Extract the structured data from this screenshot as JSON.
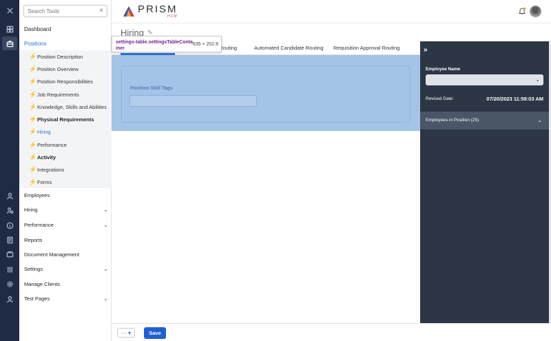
{
  "rail": {
    "close_icon": "close-icon",
    "items_top": [
      "dashboard-icon",
      "briefcase-icon"
    ],
    "items_bottom": [
      "user-icon",
      "users-icon",
      "info-icon",
      "report-icon",
      "document-icon",
      "sliders-icon",
      "gear-icon",
      "person-icon"
    ]
  },
  "sidebar": {
    "search_placeholder": "Search Tools",
    "clear": "×",
    "dashboard": "Dashboard",
    "positions": "Positions",
    "position_items": [
      "Position Description",
      "Position Overview",
      "Position Responsibilities",
      "Job Requirements",
      "Knowledge, Skills and Abilities",
      "Physical Requirements",
      "Hiring",
      "Performance",
      "Activity",
      "Integrations",
      "Forms"
    ],
    "bottom_items": [
      "Employees",
      "Hiring",
      "Performance",
      "Reports",
      "Document Management",
      "Settings",
      "Manage Clients",
      "Test Pages"
    ],
    "chevron": "⌄",
    "bolt": "⚡"
  },
  "header": {
    "logo_word": "PRISM",
    "logo_sub": "HCM"
  },
  "main": {
    "title": "Hiring",
    "edit_glyph": "✎",
    "tabs": [
      "n Routing",
      "Automated Candidate Routing",
      "Requisition Approval Routing"
    ],
    "skill_tags_label": "Position Skill Tags"
  },
  "tooltip": {
    "name": "settings-table.settingsTableContainer",
    "size": "835 × 202.8"
  },
  "right_panel": {
    "collapse_glyph": "»",
    "employee_name_label": "Employee Name",
    "revised_date_label": "Revised Date:",
    "revised_date_value": "07/20/2023 11:59:03 AM",
    "employees_in_position": "Employees in Position (25)",
    "chevron": "⌄"
  },
  "footer": {
    "more_label": "··· ▾",
    "save_label": "Save"
  },
  "colors": {
    "rail": "#1f2a44",
    "accent": "#2f6fd6",
    "highlight": "#a3c3e8",
    "right_panel": "#2c3645",
    "save": "#1f5fd1"
  }
}
